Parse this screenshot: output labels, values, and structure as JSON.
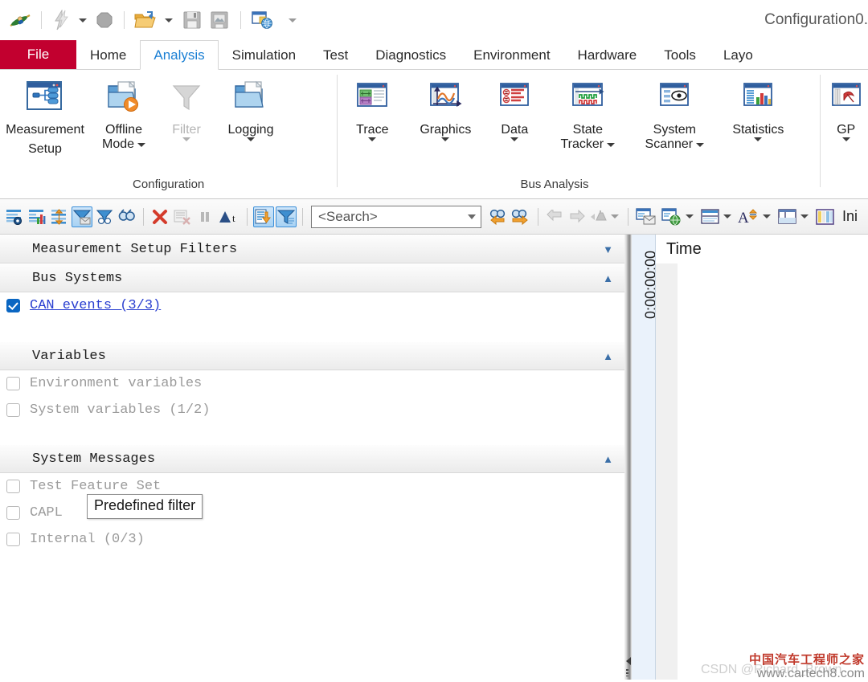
{
  "window": {
    "title": "Configuration0."
  },
  "quick_access": [
    {
      "name": "app-logo-icon",
      "icon": "canoe-logo"
    },
    {
      "name": "flash-icon",
      "icon": "lightning"
    },
    {
      "name": "flash-dropdown",
      "icon": "caret-down"
    },
    {
      "name": "stop-icon",
      "icon": "octagon"
    },
    {
      "name": "open-icon",
      "icon": "folder-open"
    },
    {
      "name": "open-dropdown",
      "icon": "caret-down"
    },
    {
      "name": "save-icon",
      "icon": "floppy-disk"
    },
    {
      "name": "save-as-icon",
      "icon": "floppy-disk-alt"
    },
    {
      "name": "print-icon",
      "icon": "window-globe"
    },
    {
      "name": "customize-dropdown",
      "icon": "caret-down"
    }
  ],
  "ribbon": {
    "file_tab": "File",
    "tabs": [
      {
        "label": "Home",
        "active": false
      },
      {
        "label": "Analysis",
        "active": true
      },
      {
        "label": "Simulation",
        "active": false
      },
      {
        "label": "Test",
        "active": false
      },
      {
        "label": "Diagnostics",
        "active": false
      },
      {
        "label": "Environment",
        "active": false
      },
      {
        "label": "Hardware",
        "active": false
      },
      {
        "label": "Tools",
        "active": false
      },
      {
        "label": "Layo",
        "active": false
      }
    ],
    "groups": [
      {
        "title": "Configuration",
        "buttons": [
          {
            "label_line1": "Measurement",
            "label_line2": "Setup",
            "icon": "measurement-setup-icon",
            "dropdown": false,
            "disabled": false
          },
          {
            "label_line1": "Offline",
            "label_line2": "Mode",
            "icon": "offline-mode-icon",
            "dropdown": true,
            "disabled": false
          },
          {
            "label_line1": "Filter",
            "label_line2": "",
            "icon": "filter-funnel-icon",
            "dropdown": true,
            "disabled": true
          },
          {
            "label_line1": "Logging",
            "label_line2": "",
            "icon": "logging-icon",
            "dropdown": true,
            "disabled": false
          }
        ]
      },
      {
        "title": "Bus Analysis",
        "buttons": [
          {
            "label_line1": "Trace",
            "label_line2": "",
            "icon": "trace-icon",
            "dropdown": true,
            "disabled": false
          },
          {
            "label_line1": "Graphics",
            "label_line2": "",
            "icon": "graphics-icon",
            "dropdown": true,
            "disabled": false
          },
          {
            "label_line1": "Data",
            "label_line2": "",
            "icon": "data-icon",
            "dropdown": true,
            "disabled": false
          },
          {
            "label_line1": "State",
            "label_line2": "Tracker",
            "icon": "state-tracker-icon",
            "dropdown": true,
            "disabled": false
          },
          {
            "label_line1": "System",
            "label_line2": "Scanner",
            "icon": "system-scanner-icon",
            "dropdown": true,
            "disabled": false
          },
          {
            "label_line1": "Statistics",
            "label_line2": "",
            "icon": "statistics-icon",
            "dropdown": true,
            "disabled": false
          }
        ]
      },
      {
        "title": "",
        "buttons": [
          {
            "label_line1": "GP",
            "label_line2": "",
            "icon": "gps-icon",
            "dropdown": true,
            "disabled": false
          }
        ]
      }
    ]
  },
  "toolbar": {
    "icons_left": [
      {
        "name": "analysis-filter-config-icon",
        "active": false
      },
      {
        "name": "statistics-view-icon",
        "active": false
      },
      {
        "name": "expand-collapse-icon",
        "active": false
      },
      {
        "name": "message-filter-icon",
        "active": true
      },
      {
        "name": "stop-filter-icon",
        "active": false
      },
      {
        "name": "find-icon",
        "active": false
      }
    ],
    "icons_mid": [
      {
        "name": "delete-icon",
        "active": false
      },
      {
        "name": "clear-window-icon",
        "active": false,
        "disabled": true
      },
      {
        "name": "pause-icon",
        "active": false,
        "disabled": true
      },
      {
        "name": "delta-time-icon",
        "active": false
      }
    ],
    "icons_toggled": [
      {
        "name": "scroll-to-end-icon",
        "active": true
      },
      {
        "name": "predefined-filter-icon",
        "active": true
      }
    ],
    "search": {
      "placeholder": "<Search>",
      "value": ""
    },
    "icons_search": [
      {
        "name": "find-previous-icon"
      },
      {
        "name": "find-next-icon"
      }
    ],
    "icons_nav": [
      {
        "name": "back-arrow-icon",
        "disabled": true
      },
      {
        "name": "forward-arrow-icon",
        "disabled": true
      },
      {
        "name": "filter-marker-icon",
        "disabled": true
      },
      {
        "name": "filter-marker-dropdown",
        "disabled": true
      }
    ],
    "icons_right": [
      {
        "name": "window-mail-icon",
        "dropdown": false
      },
      {
        "name": "window-globe-icon",
        "dropdown": true
      },
      {
        "name": "split-view-icon",
        "dropdown": true
      },
      {
        "name": "font-size-icon",
        "dropdown": true
      },
      {
        "name": "layout-pane-icon",
        "dropdown": true
      },
      {
        "name": "columns-icon",
        "dropdown": false
      }
    ],
    "right_label": "Ini"
  },
  "filter_panel": {
    "sections": [
      {
        "title": "Measurement Setup Filters",
        "chevron": "down",
        "items": []
      },
      {
        "title": "Bus Systems",
        "chevron": "up",
        "items": [
          {
            "label": "CAN events (3/3)",
            "checked": true,
            "link": true
          }
        ]
      },
      {
        "title": "Variables",
        "chevron": "up",
        "items": [
          {
            "label": "Environment variables",
            "checked": false,
            "link": false
          },
          {
            "label": "System variables (1/2)",
            "checked": false,
            "link": false
          }
        ]
      },
      {
        "title": "System Messages",
        "chevron": "up",
        "items": [
          {
            "label": "Test Feature Set",
            "checked": false,
            "link": false
          },
          {
            "label": "CAPL",
            "checked": false,
            "link": false
          },
          {
            "label": "Internal (0/3)",
            "checked": false,
            "link": false
          }
        ]
      }
    ],
    "tooltip": "Predefined filter"
  },
  "trace_pane": {
    "time_gutter_label": "0:00:00:00",
    "column_header": "Time"
  },
  "watermark": {
    "csdn": "CSDN @Richard_Brown",
    "cn_title": "中国汽车工程师之家",
    "url": "www.cartech8.com"
  },
  "colors": {
    "file_tab_red": "#c2002f",
    "active_tab_blue": "#1a7fd4",
    "link_blue": "#2a3fd0",
    "checkbox_blue": "#0a66c2"
  }
}
